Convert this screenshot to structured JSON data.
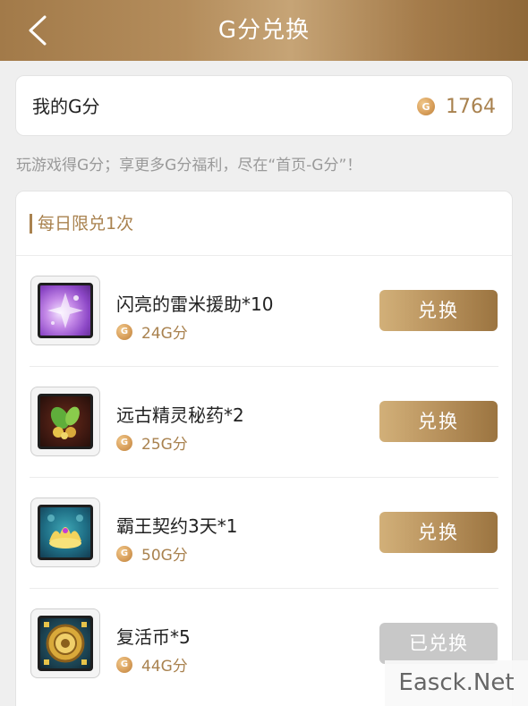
{
  "header": {
    "title": "G分兑换"
  },
  "balance": {
    "label": "我的G分",
    "coin_letter": "G",
    "value": "1764"
  },
  "hint": "玩游戏得G分；享更多G分福利，尽在“首页-G分”！",
  "section": {
    "title": "每日限兑1次"
  },
  "items": [
    {
      "name": "闪亮的雷米援助*10",
      "cost": "24G分",
      "button": "兑换",
      "icon": "purple-crystal-icon"
    },
    {
      "name": "远古精灵秘药*2",
      "cost": "25G分",
      "button": "兑换",
      "icon": "herb-potion-icon"
    },
    {
      "name": "霸王契约3天*1",
      "cost": "50G分",
      "button": "兑换",
      "icon": "golden-crown-icon"
    },
    {
      "name": "复活币*5",
      "cost": "44G分",
      "button": "已兑换",
      "icon": "revive-coin-icon"
    }
  ],
  "watermark": "Easck.Net",
  "colors": {
    "accent": "#a9824f",
    "disabled_button": "#c8c8c8"
  }
}
